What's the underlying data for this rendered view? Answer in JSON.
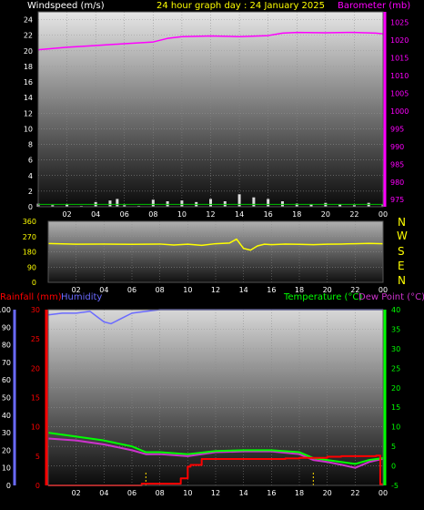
{
  "header": {
    "left_label": "Windspeed (m/s)",
    "title": "24 hour graph day : 24 January 2025",
    "right_label": "Barometer (mb)"
  },
  "colors": {
    "windspeed": "#ffffff",
    "barometer": "#ff00ff",
    "title": "#ffff00",
    "direction": "#ffff00",
    "rainfall": "#ff0000",
    "humidity": "#6a6aff",
    "temperature": "#00ff00",
    "dewpoint": "#cc33cc",
    "compass": "#ffff00"
  },
  "compass": [
    "N",
    "W",
    "S",
    "E",
    "N"
  ],
  "lower_header": {
    "rain_label": "Rainfall (mm)",
    "hum_label": "Humidity",
    "temp_label": "Temperature (°C)",
    "dew_label": "Dew Point (°C)"
  },
  "chart_data": [
    {
      "type": "line",
      "title": "24 hour graph day : 24 January 2025",
      "x_ticks": [
        "02",
        "04",
        "06",
        "08",
        "10",
        "12",
        "14",
        "16",
        "18",
        "20",
        "22",
        "00"
      ],
      "y_left": {
        "label": "Windspeed (m/s)",
        "ticks": [
          0,
          2,
          4,
          6,
          8,
          10,
          12,
          14,
          16,
          18,
          20,
          22,
          24
        ],
        "range": [
          0,
          25
        ]
      },
      "y_right": {
        "label": "Barometer (mb)",
        "ticks": [
          975,
          980,
          985,
          990,
          995,
          1000,
          1005,
          1010,
          1015,
          1020,
          1025
        ],
        "range": [
          973,
          1028
        ]
      },
      "series": [
        {
          "name": "Barometer (mb)",
          "x": [
            0,
            2,
            4,
            6,
            8,
            9,
            10,
            12,
            14,
            16,
            17,
            18,
            20,
            22,
            23.5,
            24
          ],
          "values": [
            1017.3,
            1018.0,
            1018.5,
            1019.0,
            1019.5,
            1020.5,
            1021.0,
            1021.2,
            1021.0,
            1021.3,
            1022.0,
            1022.2,
            1022.1,
            1022.2,
            1022.0,
            1021.8
          ]
        },
        {
          "name": "Windspeed (m/s)",
          "x": [
            0,
            1,
            2,
            3,
            4,
            5,
            5.5,
            6,
            7,
            8,
            9,
            10,
            11,
            12,
            13,
            14,
            15,
            16,
            17,
            18,
            19,
            20,
            21,
            22,
            23,
            24
          ],
          "values": [
            0.4,
            0.2,
            0.3,
            0.1,
            0.6,
            0.8,
            1.0,
            0.2,
            0.1,
            0.9,
            0.7,
            0.8,
            0.6,
            1.0,
            0.7,
            1.6,
            1.2,
            1.0,
            0.7,
            0.4,
            0.3,
            0.5,
            0.3,
            0.2,
            0.5,
            0.3
          ]
        }
      ]
    },
    {
      "type": "line",
      "title": "",
      "x_ticks": [
        "02",
        "04",
        "06",
        "08",
        "10",
        "12",
        "14",
        "16",
        "18",
        "20",
        "22",
        "00"
      ],
      "y_left": {
        "label": "",
        "ticks": [
          0,
          90,
          180,
          270,
          360
        ],
        "range": [
          0,
          360
        ]
      },
      "series": [
        {
          "name": "",
          "x": [
            0,
            2,
            4,
            6,
            8,
            9,
            10,
            11,
            12,
            13,
            13.5,
            14,
            14.5,
            15,
            15.5,
            16,
            17,
            18,
            19,
            20,
            21,
            22,
            23,
            24
          ],
          "values": [
            229,
            225,
            226,
            224,
            226,
            220,
            225,
            218,
            228,
            232,
            255,
            200,
            190,
            215,
            225,
            222,
            226,
            224,
            222,
            225,
            226,
            228,
            230,
            228
          ]
        }
      ]
    },
    {
      "type": "line",
      "title": "",
      "x_ticks": [
        "02",
        "04",
        "06",
        "08",
        "10",
        "12",
        "14",
        "16",
        "18",
        "20",
        "22",
        "00"
      ],
      "y_left": {
        "label": "Rainfall (mm)",
        "ticks": [
          0,
          5,
          10,
          15,
          20,
          25,
          30
        ],
        "range": [
          0,
          30
        ]
      },
      "y_far_left": {
        "label": "Humidity",
        "ticks": [
          0,
          10,
          20,
          30,
          40,
          50,
          60,
          70,
          80,
          90,
          100
        ],
        "range": [
          0,
          100
        ]
      },
      "y_right": {
        "label": "Temperature (°C)",
        "ticks": [
          -5,
          0,
          5,
          10,
          15,
          20,
          25,
          30,
          35,
          40
        ],
        "range": [
          -5,
          40
        ]
      },
      "series": [
        {
          "name": "Rainfall (mm)",
          "x": [
            0,
            6.7,
            6.7,
            8.3,
            9.5,
            10,
            10.2,
            11,
            17,
            18,
            19,
            20,
            21,
            22,
            22.5,
            23.5,
            23.8,
            24
          ],
          "values": [
            0,
            0,
            0.3,
            0.3,
            1.2,
            3.2,
            3.5,
            4.5,
            4.6,
            4.7,
            4.7,
            4.9,
            5.0,
            5.0,
            5.0,
            5.1,
            0.2,
            0.2
          ]
        },
        {
          "name": "Humidity",
          "x": [
            0,
            1,
            2,
            3,
            3.5,
            4,
            4.5,
            5,
            5.5,
            6,
            7,
            8,
            24
          ],
          "values": [
            97,
            98,
            98,
            99,
            96,
            93,
            92,
            94,
            96,
            98,
            99,
            100,
            100
          ]
        },
        {
          "name": "Temperature (°C)",
          "x": [
            0,
            2,
            4,
            6,
            7,
            8,
            10,
            12,
            14,
            16,
            18,
            19,
            20,
            21,
            22,
            23,
            24
          ],
          "values": [
            8.5,
            7.5,
            6.5,
            5.0,
            3.5,
            3.5,
            3.0,
            3.8,
            4.0,
            4.0,
            3.5,
            2.0,
            1.5,
            1.0,
            0.5,
            1.5,
            2.0
          ]
        },
        {
          "name": "Dew Point (°C)",
          "x": [
            0,
            2,
            4,
            6,
            7,
            8,
            10,
            12,
            14,
            16,
            18,
            19,
            20,
            21,
            22,
            23,
            24
          ],
          "values": [
            7.0,
            6.5,
            5.5,
            4.0,
            3.0,
            3.0,
            2.5,
            3.5,
            3.7,
            3.7,
            3.0,
            1.5,
            1.0,
            0.3,
            -0.5,
            1.0,
            1.8
          ]
        }
      ]
    }
  ]
}
